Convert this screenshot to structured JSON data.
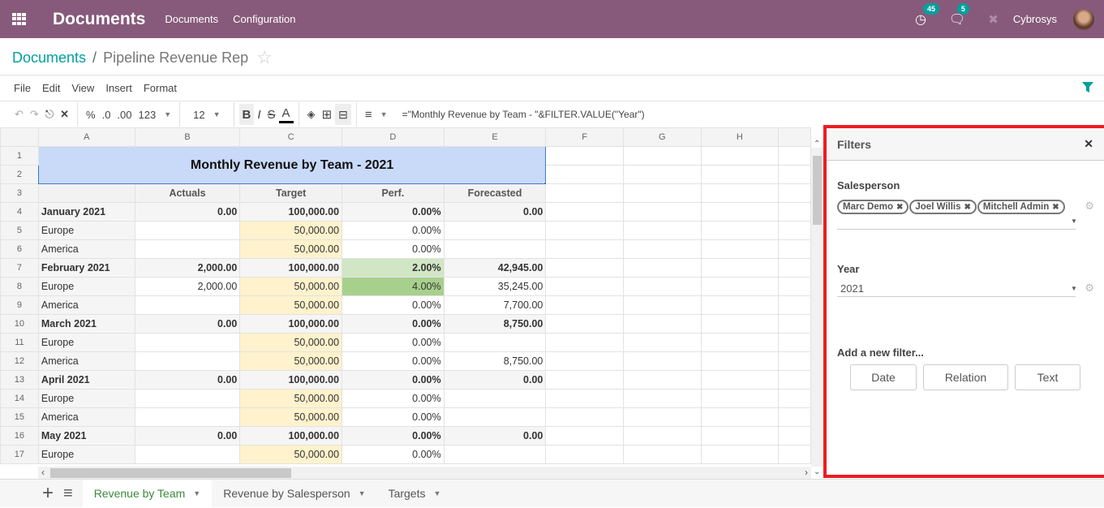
{
  "topbar": {
    "brand": "Documents",
    "menus": [
      "Documents",
      "Configuration"
    ],
    "activity_count": "45",
    "message_count": "5",
    "user_name": "Cybrosys"
  },
  "breadcrumb": {
    "parent": "Documents",
    "separator": "/",
    "current": "Pipeline Revenue Rep"
  },
  "menubar": [
    "File",
    "Edit",
    "View",
    "Insert",
    "Format"
  ],
  "toolbar": {
    "percent": "%",
    "dec_less": ".0",
    "dec_more": ".00",
    "format": "123",
    "font_size": "12",
    "bold": "B",
    "italic": "I",
    "strike": "S",
    "text_color": "A",
    "formula": "=\"Monthly Revenue by Team - \"&FILTER.VALUE(\"Year\")"
  },
  "grid": {
    "columns": [
      "A",
      "B",
      "C",
      "D",
      "E",
      "F",
      "G",
      "H"
    ],
    "title": "Monthly Revenue by Team - 2021",
    "headers": [
      "",
      "Actuals",
      "Target",
      "Perf.",
      "Forecasted"
    ],
    "rows": [
      {
        "n": "4",
        "type": "month",
        "a": "January 2021",
        "b": "0.00",
        "c": "100,000.00",
        "d": "0.00%",
        "e": "0.00"
      },
      {
        "n": "5",
        "type": "team",
        "a": "Europe",
        "b": "",
        "c": "50,000.00",
        "d": "0.00%",
        "e": ""
      },
      {
        "n": "6",
        "type": "team",
        "a": "America",
        "b": "",
        "c": "50,000.00",
        "d": "0.00%",
        "e": ""
      },
      {
        "n": "7",
        "type": "month",
        "a": "February 2021",
        "b": "2,000.00",
        "c": "100,000.00",
        "d": "2.00%",
        "e": "42,945.00"
      },
      {
        "n": "8",
        "type": "team",
        "a": "Europe",
        "b": "2,000.00",
        "c": "50,000.00",
        "d": "4.00%",
        "e": "35,245.00"
      },
      {
        "n": "9",
        "type": "team",
        "a": "America",
        "b": "",
        "c": "50,000.00",
        "d": "0.00%",
        "e": "7,700.00"
      },
      {
        "n": "10",
        "type": "month",
        "a": "March 2021",
        "b": "0.00",
        "c": "100,000.00",
        "d": "0.00%",
        "e": "8,750.00"
      },
      {
        "n": "11",
        "type": "team",
        "a": "Europe",
        "b": "",
        "c": "50,000.00",
        "d": "0.00%",
        "e": ""
      },
      {
        "n": "12",
        "type": "team",
        "a": "America",
        "b": "",
        "c": "50,000.00",
        "d": "0.00%",
        "e": "8,750.00"
      },
      {
        "n": "13",
        "type": "month",
        "a": "April 2021",
        "b": "0.00",
        "c": "100,000.00",
        "d": "0.00%",
        "e": "0.00"
      },
      {
        "n": "14",
        "type": "team",
        "a": "Europe",
        "b": "",
        "c": "50,000.00",
        "d": "0.00%",
        "e": ""
      },
      {
        "n": "15",
        "type": "team",
        "a": "America",
        "b": "",
        "c": "50,000.00",
        "d": "0.00%",
        "e": ""
      },
      {
        "n": "16",
        "type": "month",
        "a": "May 2021",
        "b": "0.00",
        "c": "100,000.00",
        "d": "0.00%",
        "e": "0.00"
      },
      {
        "n": "17",
        "type": "team",
        "a": "Europe",
        "b": "",
        "c": "50,000.00",
        "d": "0.00%",
        "e": ""
      }
    ]
  },
  "sheets": [
    {
      "label": "Revenue by Team",
      "active": true
    },
    {
      "label": "Revenue by Salesperson",
      "active": false
    },
    {
      "label": "Targets",
      "active": false
    }
  ],
  "filters": {
    "title": "Filters",
    "salesperson_label": "Salesperson",
    "salesperson_tags": [
      "Marc Demo",
      "Joel Willis",
      "Mitchell Admin"
    ],
    "year_label": "Year",
    "year_value": "2021",
    "add_label": "Add a new filter...",
    "buttons": [
      "Date",
      "Relation",
      "Text"
    ]
  },
  "colors": {
    "brand": "#875a7b",
    "accent": "#00a09d",
    "highlight_border": "#ed1c24"
  }
}
